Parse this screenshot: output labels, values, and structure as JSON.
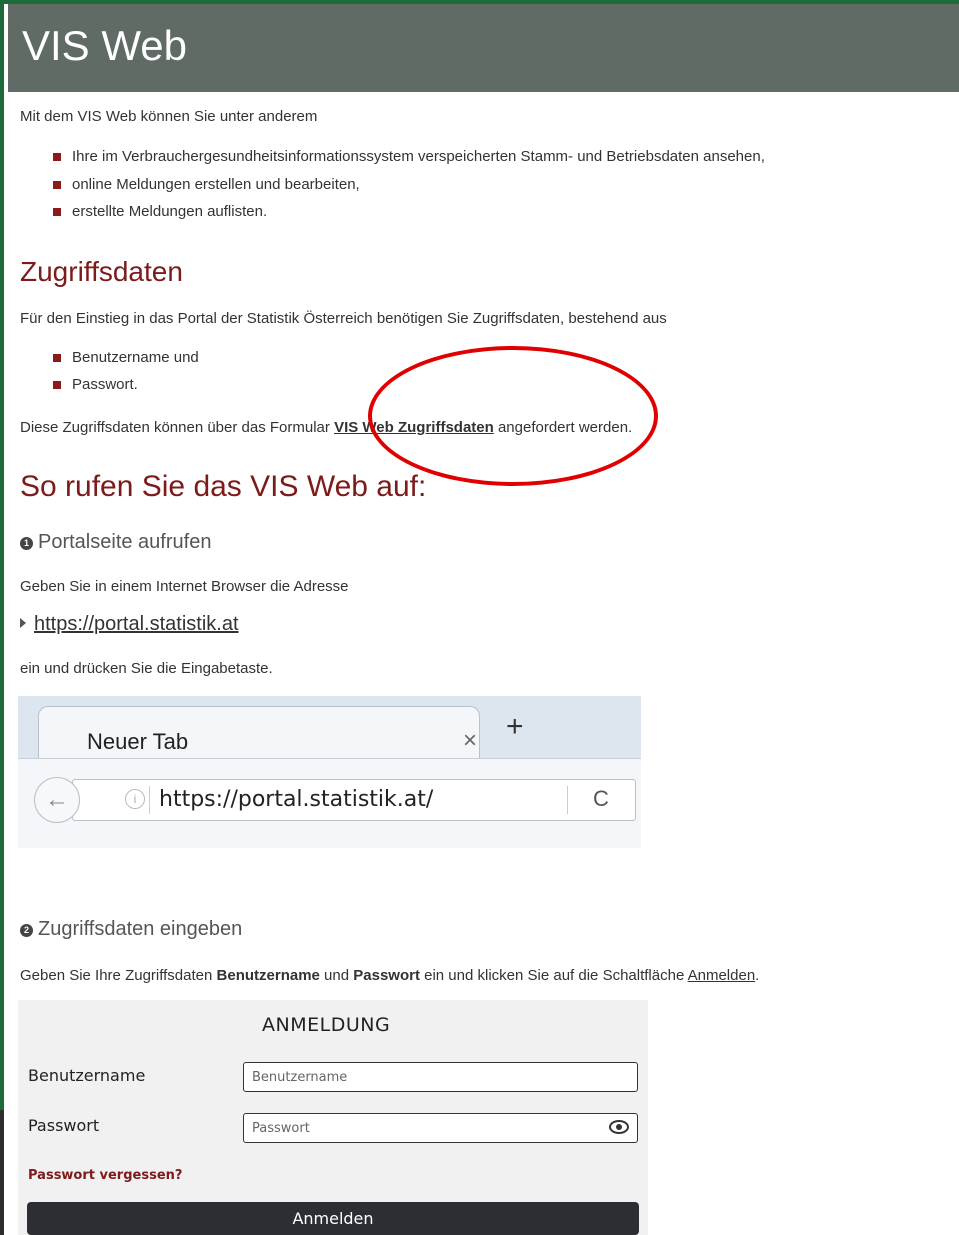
{
  "header": {
    "title": "VIS Web"
  },
  "intro": {
    "text": "Mit dem VIS Web können Sie unter anderem",
    "bullets": [
      "Ihre im Verbrauchergesundheitsinformationssystem verspeicherten Stamm- und Betriebsdaten ansehen,",
      "online Meldungen erstellen und bearbeiten,",
      "erstellte Meldungen auflisten."
    ]
  },
  "zugriff": {
    "heading": "Zugriffsdaten",
    "text": "Für den Einstieg in das Portal der Statistik Österreich benötigen Sie Zugriffsdaten, bestehend aus",
    "bullets": [
      "Benutzername und",
      "Passwort."
    ],
    "request_prefix": "Diese Zugriffsdaten können über das Formular ",
    "request_link": "VIS Web Zugriffsdaten",
    "request_suffix": " angefordert werden."
  },
  "howto": {
    "heading": "So rufen Sie das VIS Web auf:",
    "step1": {
      "number": "1",
      "title": "Portalseite aufrufen",
      "text1": "Geben Sie in einem Internet Browser die Adresse",
      "link": "https://portal.statistik.at",
      "text2": "ein und drücken Sie die Eingabetaste."
    },
    "browser": {
      "tab_label": "Neuer Tab",
      "close_glyph": "×",
      "plus_glyph": "+",
      "back_glyph": "←",
      "info_glyph": "i",
      "url": "https://portal.statistik.at/",
      "reload_glyph": "C"
    },
    "step2": {
      "number": "2",
      "title": "Zugriffsdaten eingeben",
      "text_a": "Geben Sie Ihre Zugriffsdaten ",
      "bold1": "Benutzername",
      "text_b": " und ",
      "bold2": "Passwort",
      "text_c": " ein und klicken Sie auf die Schaltfläche ",
      "link": "Anmelden",
      "text_d": "."
    },
    "login": {
      "title": "ANMELDUNG",
      "username_label": "Benutzername",
      "username_placeholder": "Benutzername",
      "password_label": "Passwort",
      "password_placeholder": "Passwort",
      "forgot": "Passwort vergessen?",
      "submit": "Anmelden"
    }
  },
  "annotation": {
    "color": "#e00000"
  }
}
